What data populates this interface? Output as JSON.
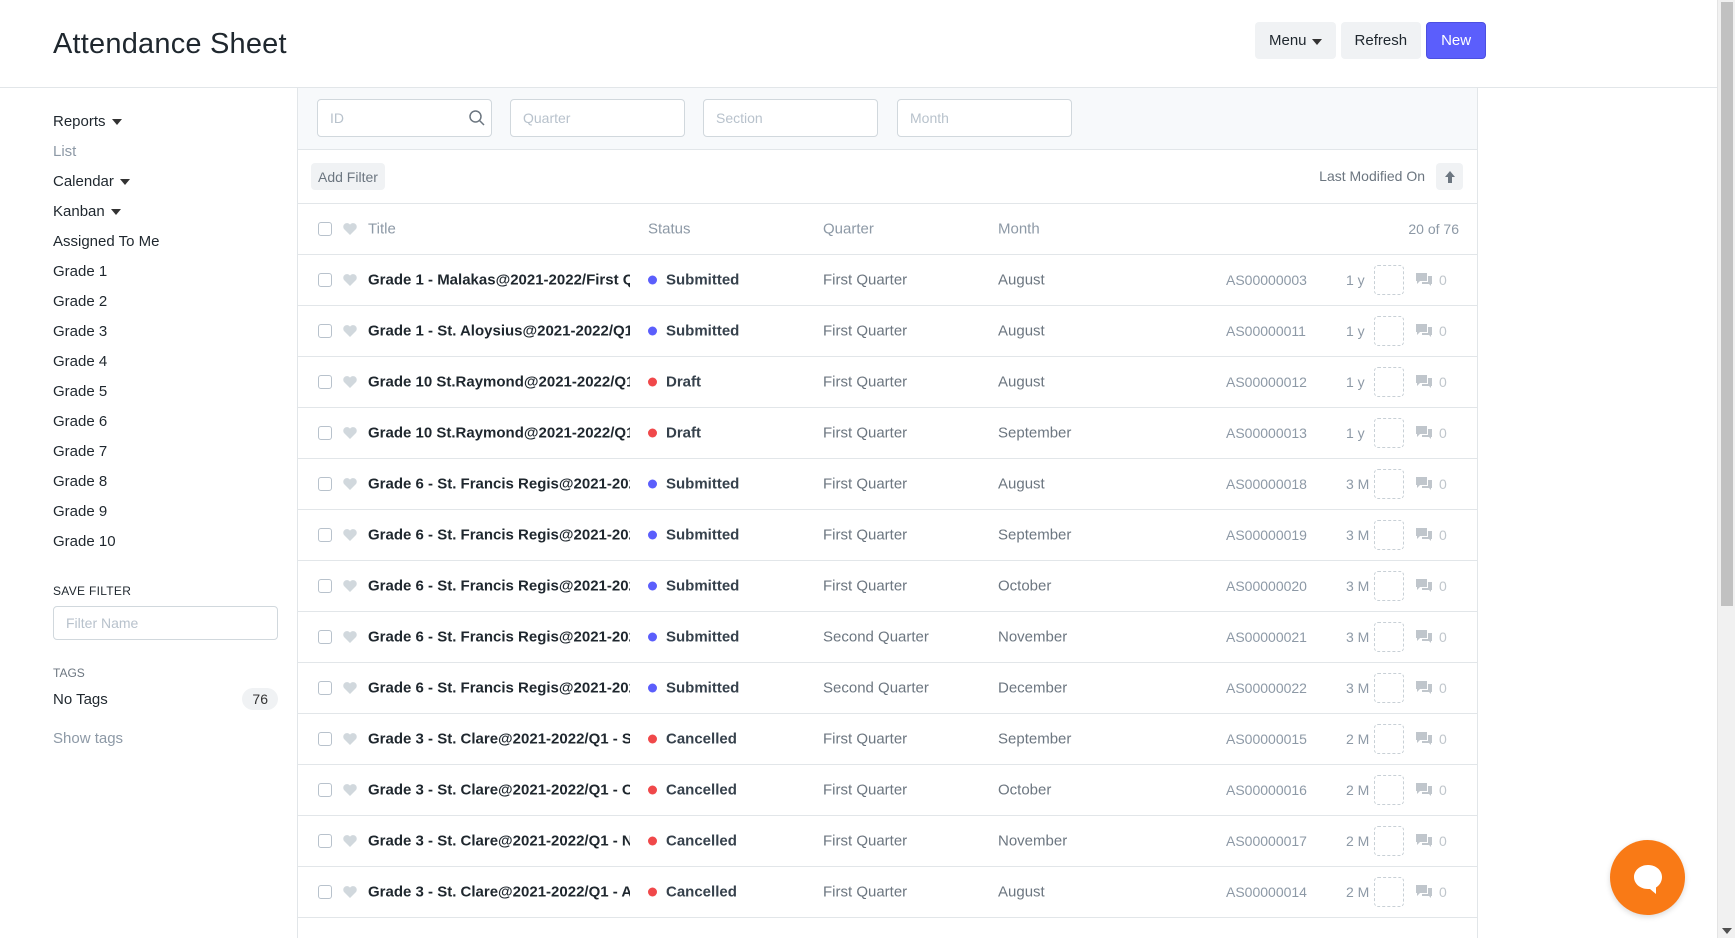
{
  "header": {
    "title": "Attendance Sheet",
    "menu_label": "Menu",
    "refresh_label": "Refresh",
    "new_label": "New"
  },
  "sidebar": {
    "items": [
      {
        "label": "Reports",
        "dropdown": true,
        "muted": false
      },
      {
        "label": "List",
        "dropdown": false,
        "muted": true
      },
      {
        "label": "Calendar",
        "dropdown": true,
        "muted": false
      },
      {
        "label": "Kanban",
        "dropdown": true,
        "muted": false
      },
      {
        "label": "Assigned To Me",
        "dropdown": false,
        "muted": false
      },
      {
        "label": "Grade 1",
        "dropdown": false,
        "muted": false
      },
      {
        "label": "Grade 2",
        "dropdown": false,
        "muted": false
      },
      {
        "label": "Grade 3",
        "dropdown": false,
        "muted": false
      },
      {
        "label": "Grade 4",
        "dropdown": false,
        "muted": false
      },
      {
        "label": "Grade 5",
        "dropdown": false,
        "muted": false
      },
      {
        "label": "Grade 6",
        "dropdown": false,
        "muted": false
      },
      {
        "label": "Grade 7",
        "dropdown": false,
        "muted": false
      },
      {
        "label": "Grade 8",
        "dropdown": false,
        "muted": false
      },
      {
        "label": "Grade 9",
        "dropdown": false,
        "muted": false
      },
      {
        "label": "Grade 10",
        "dropdown": false,
        "muted": false
      }
    ],
    "save_filter_label": "SAVE FILTER",
    "filter_name_placeholder": "Filter Name",
    "tags_label": "TAGS",
    "no_tags_label": "No Tags",
    "no_tags_count": "76",
    "show_tags_label": "Show tags"
  },
  "filters": {
    "id_placeholder": "ID",
    "quarter_placeholder": "Quarter",
    "section_placeholder": "Section",
    "month_placeholder": "Month",
    "add_filter_label": "Add Filter",
    "sort_label": "Last Modified On"
  },
  "table": {
    "columns": {
      "title": "Title",
      "status": "Status",
      "quarter": "Quarter",
      "month": "Month",
      "count": "20 of 76"
    },
    "status_colors": {
      "Submitted": "#5b5efc",
      "Draft": "#f0484a",
      "Cancelled": "#f0484a"
    },
    "rows": [
      {
        "title": "Grade 1 - Malakas@2021-2022/First Q",
        "status": "Submitted",
        "quarter": "First Quarter",
        "month": "August",
        "id": "AS00000003",
        "age": "1 y",
        "comments": "0"
      },
      {
        "title": "Grade 1 - St. Aloysius@2021-2022/Q1",
        "status": "Submitted",
        "quarter": "First Quarter",
        "month": "August",
        "id": "AS00000011",
        "age": "1 y",
        "comments": "0"
      },
      {
        "title": "Grade 10 St.Raymond@2021-2022/Q1",
        "status": "Draft",
        "quarter": "First Quarter",
        "month": "August",
        "id": "AS00000012",
        "age": "1 y",
        "comments": "0"
      },
      {
        "title": "Grade 10 St.Raymond@2021-2022/Q1",
        "status": "Draft",
        "quarter": "First Quarter",
        "month": "September",
        "id": "AS00000013",
        "age": "1 y",
        "comments": "0"
      },
      {
        "title": "Grade 6 - St. Francis Regis@2021-202",
        "status": "Submitted",
        "quarter": "First Quarter",
        "month": "August",
        "id": "AS00000018",
        "age": "3 M",
        "comments": "0"
      },
      {
        "title": "Grade 6 - St. Francis Regis@2021-202",
        "status": "Submitted",
        "quarter": "First Quarter",
        "month": "September",
        "id": "AS00000019",
        "age": "3 M",
        "comments": "0"
      },
      {
        "title": "Grade 6 - St. Francis Regis@2021-202",
        "status": "Submitted",
        "quarter": "First Quarter",
        "month": "October",
        "id": "AS00000020",
        "age": "3 M",
        "comments": "0"
      },
      {
        "title": "Grade 6 - St. Francis Regis@2021-202",
        "status": "Submitted",
        "quarter": "Second Quarter",
        "month": "November",
        "id": "AS00000021",
        "age": "3 M",
        "comments": "0"
      },
      {
        "title": "Grade 6 - St. Francis Regis@2021-202",
        "status": "Submitted",
        "quarter": "Second Quarter",
        "month": "December",
        "id": "AS00000022",
        "age": "3 M",
        "comments": "0"
      },
      {
        "title": "Grade 3 - St. Clare@2021-2022/Q1 - S",
        "status": "Cancelled",
        "quarter": "First Quarter",
        "month": "September",
        "id": "AS00000015",
        "age": "2 M",
        "comments": "0"
      },
      {
        "title": "Grade 3 - St. Clare@2021-2022/Q1 - O",
        "status": "Cancelled",
        "quarter": "First Quarter",
        "month": "October",
        "id": "AS00000016",
        "age": "2 M",
        "comments": "0"
      },
      {
        "title": "Grade 3 - St. Clare@2021-2022/Q1 - N",
        "status": "Cancelled",
        "quarter": "First Quarter",
        "month": "November",
        "id": "AS00000017",
        "age": "2 M",
        "comments": "0"
      },
      {
        "title": "Grade 3 - St. Clare@2021-2022/Q1 - A",
        "status": "Cancelled",
        "quarter": "First Quarter",
        "month": "August",
        "id": "AS00000014",
        "age": "2 M",
        "comments": "0"
      }
    ]
  },
  "colors": {
    "accent": "#5b5efc",
    "chat": "#f97a16"
  }
}
